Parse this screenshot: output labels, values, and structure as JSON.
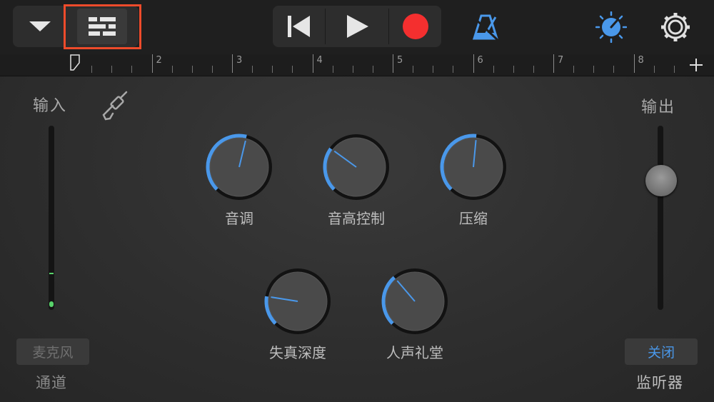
{
  "ruler": {
    "numbers": [
      "2",
      "3",
      "4",
      "5",
      "6",
      "7",
      "8"
    ]
  },
  "input": {
    "label": "输入",
    "source_button": "麦克风",
    "channel_label": "通道"
  },
  "output": {
    "label": "输出",
    "monitor_button": "关闭",
    "monitor_label": "监听器",
    "volume_level": 0.7
  },
  "knobs": [
    {
      "label": "音调",
      "value": 0.55
    },
    {
      "label": "音高控制",
      "value": 0.3
    },
    {
      "label": "压缩",
      "value": 0.52
    },
    {
      "label": "失真深度",
      "value": 0.2
    },
    {
      "label": "人声礼堂",
      "value": 0.35
    }
  ],
  "colors": {
    "accent": "#4a98ea",
    "record": "#f42f2f",
    "highlight": "#ee4b2b"
  },
  "icons": {
    "dropdown": "chevron-down-icon",
    "tracks_view": "tracks-view-icon",
    "rewind": "skip-back-icon",
    "play": "play-icon",
    "record": "record-icon",
    "metronome": "metronome-icon",
    "master_effects": "dial-icon",
    "settings": "gear-icon",
    "input_jack": "audio-jack-icon",
    "add_section": "plus-icon"
  }
}
